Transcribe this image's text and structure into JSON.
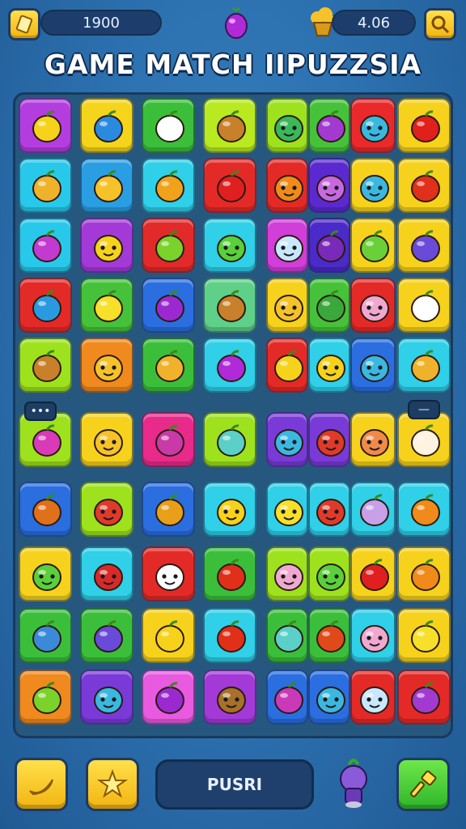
{
  "header": {
    "score_value": "1900",
    "coins_value": "4.06"
  },
  "title": "GAME MATCH IIPUZZSIA",
  "icons": {
    "top_left": "card-icon",
    "top_center": "berry-icon",
    "top_right_coin": "cupcake-icon",
    "search": "search-icon"
  },
  "board": {
    "mini_left": "•••",
    "mini_right": "—",
    "tiles": [
      {
        "color": "#b43de0",
        "fruit": "banana"
      },
      {
        "color": "#f4d51c",
        "fruit": "donut"
      },
      {
        "color": "#3bbf3a",
        "fruit": "cake"
      },
      {
        "color": "#b8ea1f",
        "fruit": "box"
      },
      {
        "color": "#9ee21e",
        "fruit": "slime"
      },
      {
        "color": "#46c23a",
        "fruit": "plum"
      },
      {
        "color": "#ea2a2a",
        "fruit": "robot"
      },
      {
        "color": "#f6d21d",
        "fruit": "strawberry"
      },
      {
        "color": "#28c8ea",
        "fruit": "burger"
      },
      {
        "color": "#2a9ee2",
        "fruit": "gem"
      },
      {
        "color": "#2fd0e8",
        "fruit": "mango"
      },
      {
        "color": "#e42a26",
        "fruit": "apple"
      },
      {
        "color": "#e42a26",
        "fruit": "orange-face"
      },
      {
        "color": "#5a2ad0",
        "fruit": "plum-face"
      },
      {
        "color": "#f6d21d",
        "fruit": "blue-face"
      },
      {
        "color": "#f6d21d",
        "fruit": "tomato"
      },
      {
        "color": "#28c8ea",
        "fruit": "candy"
      },
      {
        "color": "#a33ad8",
        "fruit": "yellow-blob"
      },
      {
        "color": "#e22a2a",
        "fruit": "lime"
      },
      {
        "color": "#2fd0e8",
        "fruit": "green-face"
      },
      {
        "color": "#d13ed8",
        "fruit": "ghost"
      },
      {
        "color": "#4a2ac8",
        "fruit": "grape"
      },
      {
        "color": "#f6d21d",
        "fruit": "leaf"
      },
      {
        "color": "#f6d21d",
        "fruit": "blueberry"
      },
      {
        "color": "#e42a26",
        "fruit": "ball"
      },
      {
        "color": "#46c23a",
        "fruit": "lemon"
      },
      {
        "color": "#2a6ee0",
        "fruit": "purple-fruit"
      },
      {
        "color": "#5fd088",
        "fruit": "box"
      },
      {
        "color": "#f6d21d",
        "fruit": "cat"
      },
      {
        "color": "#46c23a",
        "fruit": "pickle"
      },
      {
        "color": "#e42a26",
        "fruit": "pink-face"
      },
      {
        "color": "#f6d21d",
        "fruit": "envelope"
      },
      {
        "color": "#9ee21e",
        "fruit": "box"
      },
      {
        "color": "#f08a1e",
        "fruit": "smile"
      },
      {
        "color": "#3bbf3a",
        "fruit": "burger"
      },
      {
        "color": "#2fd0e8",
        "fruit": "eggplant"
      },
      {
        "color": "#e42a26",
        "fruit": "cheese"
      },
      {
        "color": "#2fd0e8",
        "fruit": "yellow-face"
      },
      {
        "color": "#2a6ee0",
        "fruit": "blue-face"
      },
      {
        "color": "#2fd0e8",
        "fruit": "burger"
      },
      {
        "color": "#9ee21e",
        "fruit": "cart"
      },
      {
        "color": "#f6d21d",
        "fruit": "boy"
      },
      {
        "color": "#e82a8a",
        "fruit": "shell"
      },
      {
        "color": "#9ee21e",
        "fruit": "icecream"
      },
      {
        "color": "#7a3ad8",
        "fruit": "duo"
      },
      {
        "color": "#7a3ad8",
        "fruit": "duo-red"
      },
      {
        "color": "#f6d21d",
        "fruit": "fox"
      },
      {
        "color": "#f6d21d",
        "fruit": "popcorn"
      },
      {
        "color": "#2a6ee0",
        "fruit": "leaf-orange"
      },
      {
        "color": "#9ee21e",
        "fruit": "red-face"
      },
      {
        "color": "#2a6ee0",
        "fruit": "seed"
      },
      {
        "color": "#2fd0e8",
        "fruit": "yellow-face"
      },
      {
        "color": "#2fd0e8",
        "fruit": "lemon-face"
      },
      {
        "color": "#2fd0e8",
        "fruit": "red-face"
      },
      {
        "color": "#2fd0e8",
        "fruit": "shell-purple"
      },
      {
        "color": "#2fd0e8",
        "fruit": "orange"
      },
      {
        "color": "#f6d21d",
        "fruit": "green-face"
      },
      {
        "color": "#2fd0e8",
        "fruit": "red-blob"
      },
      {
        "color": "#e42a26",
        "fruit": "ghost-white"
      },
      {
        "color": "#3bbf3a",
        "fruit": "tomato"
      },
      {
        "color": "#9ee21e",
        "fruit": "pink-face"
      },
      {
        "color": "#9ee21e",
        "fruit": "green-face"
      },
      {
        "color": "#f6d21d",
        "fruit": "apple"
      },
      {
        "color": "#f6d21d",
        "fruit": "orange"
      },
      {
        "color": "#3bbf3a",
        "fruit": "bone"
      },
      {
        "color": "#3bbf3a",
        "fruit": "blueberry"
      },
      {
        "color": "#f6d21d",
        "fruit": "star"
      },
      {
        "color": "#2fd0e8",
        "fruit": "tomato"
      },
      {
        "color": "#3bbf3a",
        "fruit": "cup"
      },
      {
        "color": "#3bbf3a",
        "fruit": "pepper"
      },
      {
        "color": "#2fd0e8",
        "fruit": "pink-face"
      },
      {
        "color": "#f6d21d",
        "fruit": "lemon"
      },
      {
        "color": "#f08a1e",
        "fruit": "lime"
      },
      {
        "color": "#7a3ad8",
        "fruit": "blue-face"
      },
      {
        "color": "#e85ae0",
        "fruit": "purple-fruit"
      },
      {
        "color": "#a33ad8",
        "fruit": "brown-face"
      },
      {
        "color": "#2a6ee0",
        "fruit": "pot"
      },
      {
        "color": "#2a6ee0",
        "fruit": "blue-face"
      },
      {
        "color": "#e42a26",
        "fruit": "ghost"
      },
      {
        "color": "#e42a26",
        "fruit": "plum"
      }
    ]
  },
  "bottom": {
    "push_label": "PUSRI",
    "left1": "banana-icon",
    "left2": "star-icon",
    "potion": "potion-icon",
    "right": "hammer-icon"
  }
}
